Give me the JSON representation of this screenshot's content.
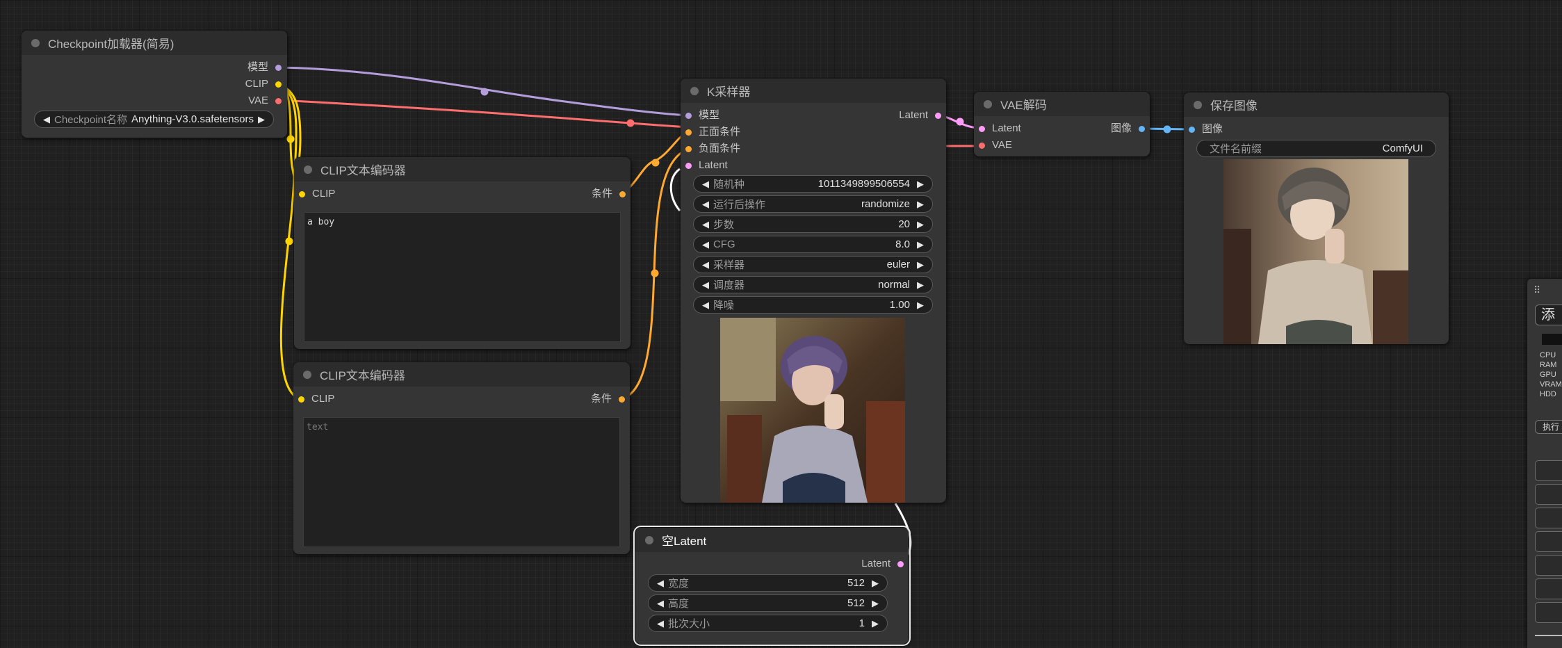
{
  "colors": {
    "model": "#b39ddb",
    "clip": "#ffd500",
    "vae": "#ff6e6e",
    "conditioning": "#ffa931",
    "latent": "#ff9cf9",
    "image": "#64b5f6"
  },
  "checkpoint_loader": {
    "title": "Checkpoint加载器(简易)",
    "outputs": [
      "模型",
      "CLIP",
      "VAE"
    ],
    "widget": {
      "label": "Checkpoint名称",
      "value": "Anything-V3.0.safetensors"
    }
  },
  "clip_encoder_positive": {
    "title": "CLIP文本编码器",
    "input": "CLIP",
    "output": "条件",
    "text": "a boy"
  },
  "clip_encoder_negative": {
    "title": "CLIP文本编码器",
    "input": "CLIP",
    "output": "条件",
    "placeholder": "text"
  },
  "ksampler": {
    "title": "K采样器",
    "inputs": [
      "模型",
      "正面条件",
      "负面条件",
      "Latent"
    ],
    "output": "Latent",
    "widgets": [
      {
        "label": "随机种",
        "value": "1011349899506554"
      },
      {
        "label": "运行后操作",
        "value": "randomize"
      },
      {
        "label": "步数",
        "value": "20"
      },
      {
        "label": "CFG",
        "value": "8.0"
      },
      {
        "label": "采样器",
        "value": "euler"
      },
      {
        "label": "调度器",
        "value": "normal"
      },
      {
        "label": "降噪",
        "value": "1.00"
      }
    ]
  },
  "vae_decode": {
    "title": "VAE解码",
    "inputs": [
      "Latent",
      "VAE"
    ],
    "output": "图像"
  },
  "save_image": {
    "title": "保存图像",
    "input": "图像",
    "widget": {
      "label": "文件名前缀",
      "value": "ComfyUI"
    }
  },
  "empty_latent": {
    "title": "空Latent",
    "output": "Latent",
    "widgets": [
      {
        "label": "宽度",
        "value": "512"
      },
      {
        "label": "高度",
        "value": "512"
      },
      {
        "label": "批次大小",
        "value": "1"
      }
    ]
  },
  "side_panel": {
    "grip": "⠿",
    "add_label": "添",
    "stats": [
      "CPU",
      "RAM",
      "GPU",
      "VRAM",
      "HDD"
    ],
    "exec_label": "执行"
  }
}
